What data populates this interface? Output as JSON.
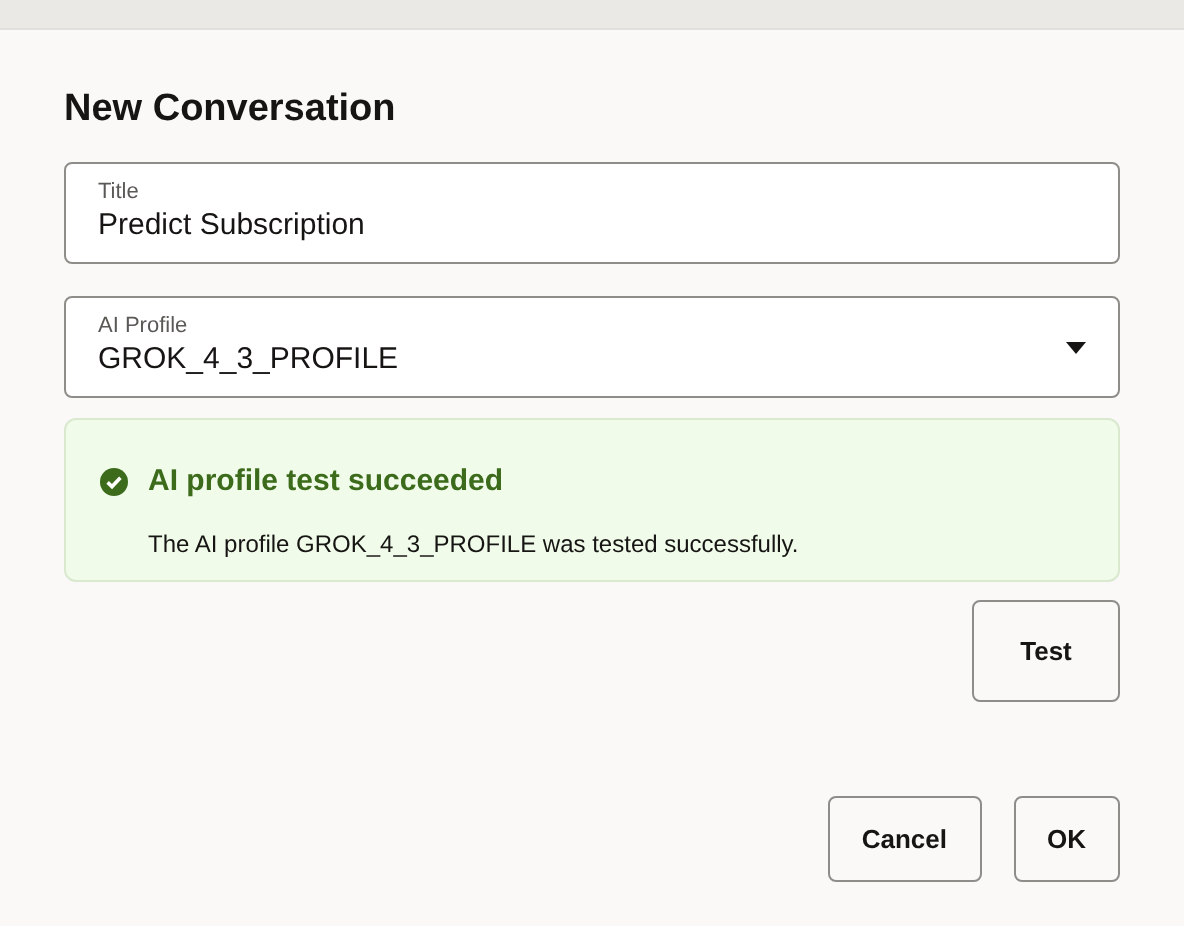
{
  "dialog": {
    "title": "New Conversation"
  },
  "fields": [
    {
      "kind": "text",
      "label": "Title",
      "value": "Predict Subscription"
    },
    {
      "kind": "select",
      "label": "AI Profile",
      "value": "GROK_4_3_PROFILE"
    }
  ],
  "message": {
    "kind": "success",
    "title": "AI profile test succeeded",
    "body": "The AI profile GROK_4_3_PROFILE was tested successfully."
  },
  "test_button": "Test",
  "buttons": [
    "Cancel",
    "OK"
  ]
}
